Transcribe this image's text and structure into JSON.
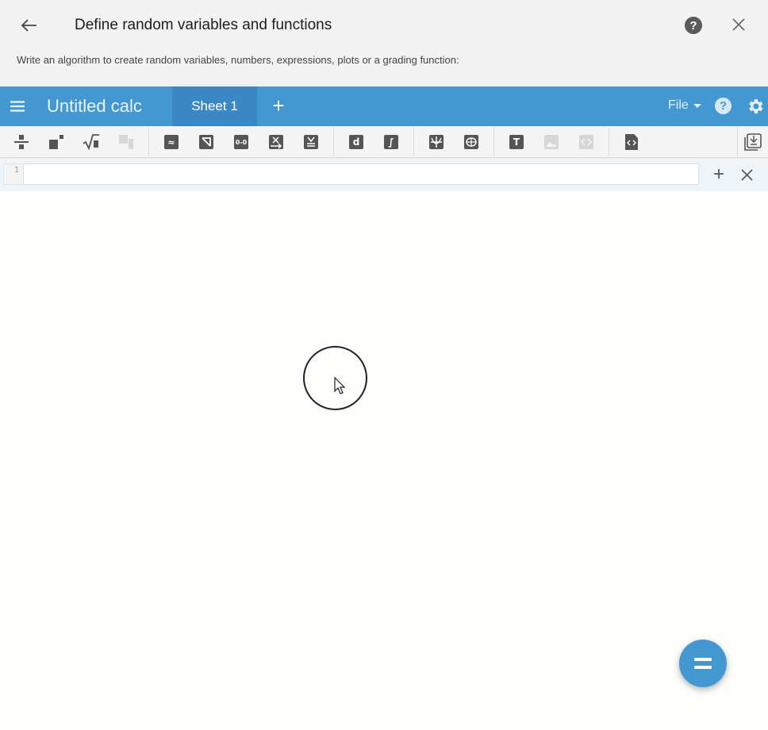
{
  "dialog": {
    "title": "Define random variables and functions",
    "description": "Write an algorithm to create random variables, numbers, expressions, plots or a grading function:",
    "help_glyph": "?"
  },
  "appbar": {
    "calc_title": "Untitled calc",
    "sheet_tab": "Sheet 1",
    "add_tab_glyph": "+",
    "file_label": "File",
    "help_glyph": "?"
  },
  "toolbar": {
    "icons": [
      "fraction-icon",
      "superscript-icon",
      "sqrt-icon",
      "subscript-icon",
      "approx-icon",
      "not-icon",
      "interval-icon",
      "vector-arrow-icon",
      "less-equal-icon",
      "derivative-icon",
      "integral-icon",
      "graph-icon",
      "globe-icon",
      "text-icon",
      "image-icon",
      "code-icon",
      "file-code-icon",
      "insert-icon"
    ],
    "approx_glyph": "≈",
    "interval_glyph": "0-0",
    "derivative_glyph": "d",
    "integral_glyph": "∫",
    "text_glyph": "T"
  },
  "editor": {
    "line_number": "1",
    "value": "",
    "add_glyph": "+"
  },
  "fab": {
    "icon": "equals-icon"
  }
}
